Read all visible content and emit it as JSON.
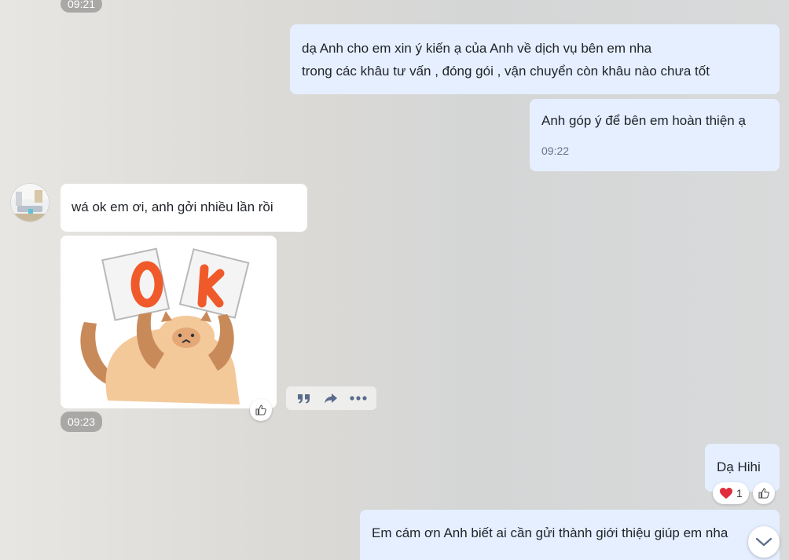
{
  "messages": [
    {
      "time": "09:21"
    },
    {
      "lines": [
        "dạ Anh cho em xin ý kiến ạ của Anh về dịch vụ bên em nha",
        "trong các khâu  tư vấn  , đóng gói  , vận chuyển  còn khâu nào chưa tốt"
      ]
    },
    {
      "text": "Anh góp ý để bên em hoàn thiện ạ",
      "time": "09:22"
    },
    {
      "text": "wá ok em ơi, anh gởi nhiều lần rồi"
    },
    {
      "sticker_text": "OK",
      "time": "09:23"
    },
    {
      "text": "Dạ Hihi",
      "reaction_count": "1"
    },
    {
      "text": "Em cám ơn Anh biết ai cần gửi thành giới thiệu giúp em nha"
    }
  ],
  "icons": {
    "like": "thumbs-up-icon",
    "quote": "quote-icon",
    "forward": "share-forward-icon",
    "more": "more-dots-icon",
    "heart": "heart-icon",
    "scroll": "chevron-down-icon"
  },
  "colors": {
    "outgoing_bubble": "#e5efff",
    "incoming_bubble": "#ffffff",
    "accent": "#5a6b8c",
    "heart": "#e02d3c"
  }
}
